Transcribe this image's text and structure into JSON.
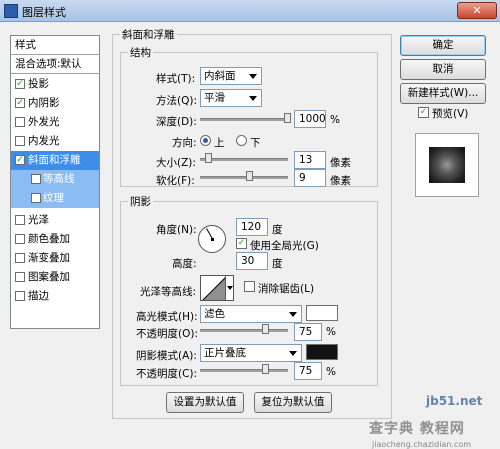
{
  "window": {
    "title": "图层样式",
    "close_glyph": "✕"
  },
  "sidebar": {
    "header": "样式",
    "blend_label": "混合选项:默认",
    "items": [
      {
        "label": "投影",
        "checked": true
      },
      {
        "label": "内阴影",
        "checked": true
      },
      {
        "label": "外发光",
        "checked": false
      },
      {
        "label": "内发光",
        "checked": false
      },
      {
        "label": "斜面和浮雕",
        "checked": true,
        "selected": true
      },
      {
        "label": "等高线",
        "checked": false,
        "sub": true
      },
      {
        "label": "纹理",
        "checked": false,
        "sub": true
      },
      {
        "label": "光泽",
        "checked": false
      },
      {
        "label": "颜色叠加",
        "checked": false
      },
      {
        "label": "渐变叠加",
        "checked": false
      },
      {
        "label": "图案叠加",
        "checked": false
      },
      {
        "label": "描边",
        "checked": false
      }
    ]
  },
  "bevel": {
    "group_title": "斜面和浮雕",
    "structure_title": "结构",
    "style_label": "样式(T):",
    "style_value": "内斜面",
    "method_label": "方法(Q):",
    "method_value": "平滑",
    "depth_label": "深度(D):",
    "depth_value": "1000",
    "depth_unit": "%",
    "direction_label": "方向:",
    "dir_up": "上",
    "dir_down": "下",
    "direction_selected": "上",
    "size_label": "大小(Z):",
    "size_value": "13",
    "size_unit": "像素",
    "soften_label": "软化(F):",
    "soften_value": "9",
    "soften_unit": "像素"
  },
  "shading": {
    "title": "阴影",
    "angle_label": "角度(N):",
    "angle_value": "120",
    "angle_unit": "度",
    "global_light_label": "使用全局光(G)",
    "global_light_checked": true,
    "altitude_label": "高度:",
    "altitude_value": "30",
    "altitude_unit": "度",
    "gloss_label": "光泽等高线:",
    "antialias_label": "消除锯齿(L)",
    "antialias_checked": false,
    "highlight_mode_label": "高光模式(H):",
    "highlight_mode_value": "滤色",
    "highlight_color": "#ffffff",
    "hl_opacity_label": "不透明度(O):",
    "hl_opacity_value": "75",
    "hl_opacity_unit": "%",
    "shadow_mode_label": "阴影模式(A):",
    "shadow_mode_value": "正片叠底",
    "shadow_color": "#101414",
    "sh_opacity_label": "不透明度(C):",
    "sh_opacity_value": "75",
    "sh_opacity_unit": "%"
  },
  "bottom": {
    "make_default": "设置为默认值",
    "reset_default": "复位为默认值"
  },
  "right": {
    "ok": "确定",
    "cancel": "取消",
    "new_style": "新建样式(W)...",
    "preview_label": "预览(V)",
    "preview_checked": true
  },
  "watermark": {
    "line1": "jb51.net",
    "line2": "查字典 教程网",
    "line3": "jiaocheng.chazidian.com"
  }
}
